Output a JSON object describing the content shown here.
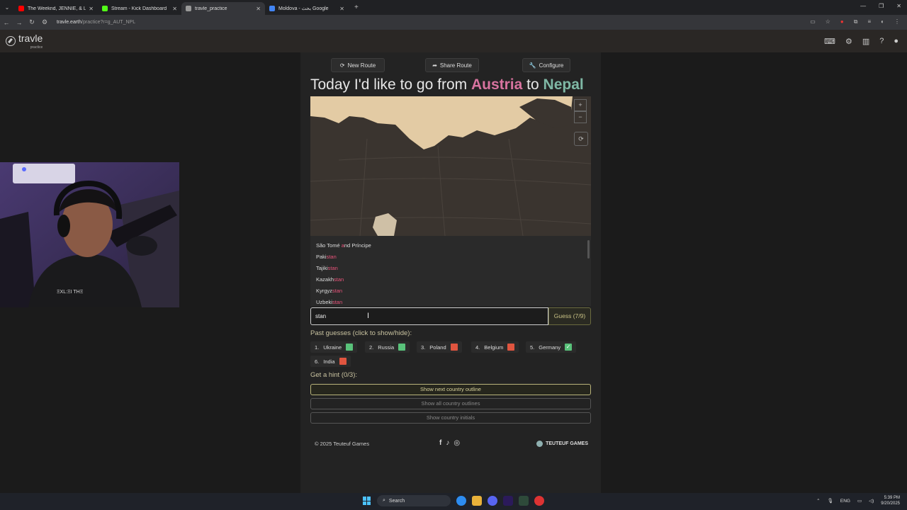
{
  "browser": {
    "tabs": [
      {
        "title": "The Weeknd, JENNIE, & Lil",
        "favicon_color": "#ff0000",
        "active": false
      },
      {
        "title": "Stream - Kick Dashboard",
        "favicon_color": "#53fc18",
        "active": false
      },
      {
        "title": "travle_practice",
        "favicon_color": "#999999",
        "active": true
      },
      {
        "title": "Moldova - بحث Google",
        "favicon_color": "#4285f4",
        "active": false
      }
    ],
    "url_host": "travle.earth",
    "url_path": "/practice?r=g_AUT_NPL"
  },
  "app": {
    "logo_text": "travle",
    "logo_sub": "practice"
  },
  "toolbar": {
    "new_route": "New Route",
    "share_route": "Share Route",
    "configure": "Configure"
  },
  "headline": {
    "prefix": "Today I'd like to go from",
    "from": "Austria",
    "connector": "to",
    "to": "Nepal"
  },
  "map": {
    "zoom_in": "+",
    "zoom_out": "−",
    "reset": "⟳"
  },
  "suggestions": [
    {
      "pre": "São Tomé ",
      "hl": "a",
      "post": "nd Príncipe"
    },
    {
      "pre": "Paki",
      "hl": "stan",
      "post": ""
    },
    {
      "pre": "Tajiki",
      "hl": "stan",
      "post": ""
    },
    {
      "pre": "Kazakh",
      "hl": "stan",
      "post": ""
    },
    {
      "pre": "Kyrgyz",
      "hl": "stan",
      "post": ""
    },
    {
      "pre": "Uzbeki",
      "hl": "stan",
      "post": ""
    }
  ],
  "guess": {
    "value": "stan",
    "button": "Guess (7/9)"
  },
  "past_guesses": {
    "title": "Past guesses (click to show/hide):",
    "items": [
      {
        "num": "1.",
        "name": "Ukraine",
        "status": "green"
      },
      {
        "num": "2.",
        "name": "Russia",
        "status": "green"
      },
      {
        "num": "3.",
        "name": "Poland",
        "status": "red"
      },
      {
        "num": "4.",
        "name": "Belgium",
        "status": "red"
      },
      {
        "num": "5.",
        "name": "Germany",
        "status": "check"
      },
      {
        "num": "6.",
        "name": "India",
        "status": "red"
      }
    ]
  },
  "hints": {
    "title": "Get a hint (0/3):",
    "next_outline": "Show next country outline",
    "all_outlines": "Show all country outlines",
    "initials": "Show country initials"
  },
  "footer": {
    "copyright": "© 2025 Teuteuf Games",
    "brand": "TEUTEUF GAMES"
  },
  "taskbar": {
    "search": "Search",
    "lang": "ENG",
    "time": "5:39 PM",
    "date": "9/20/2025"
  },
  "colors": {
    "from": "#d8739f",
    "to": "#7fb8a5",
    "green": "#59c27a",
    "red": "#e0553f"
  }
}
